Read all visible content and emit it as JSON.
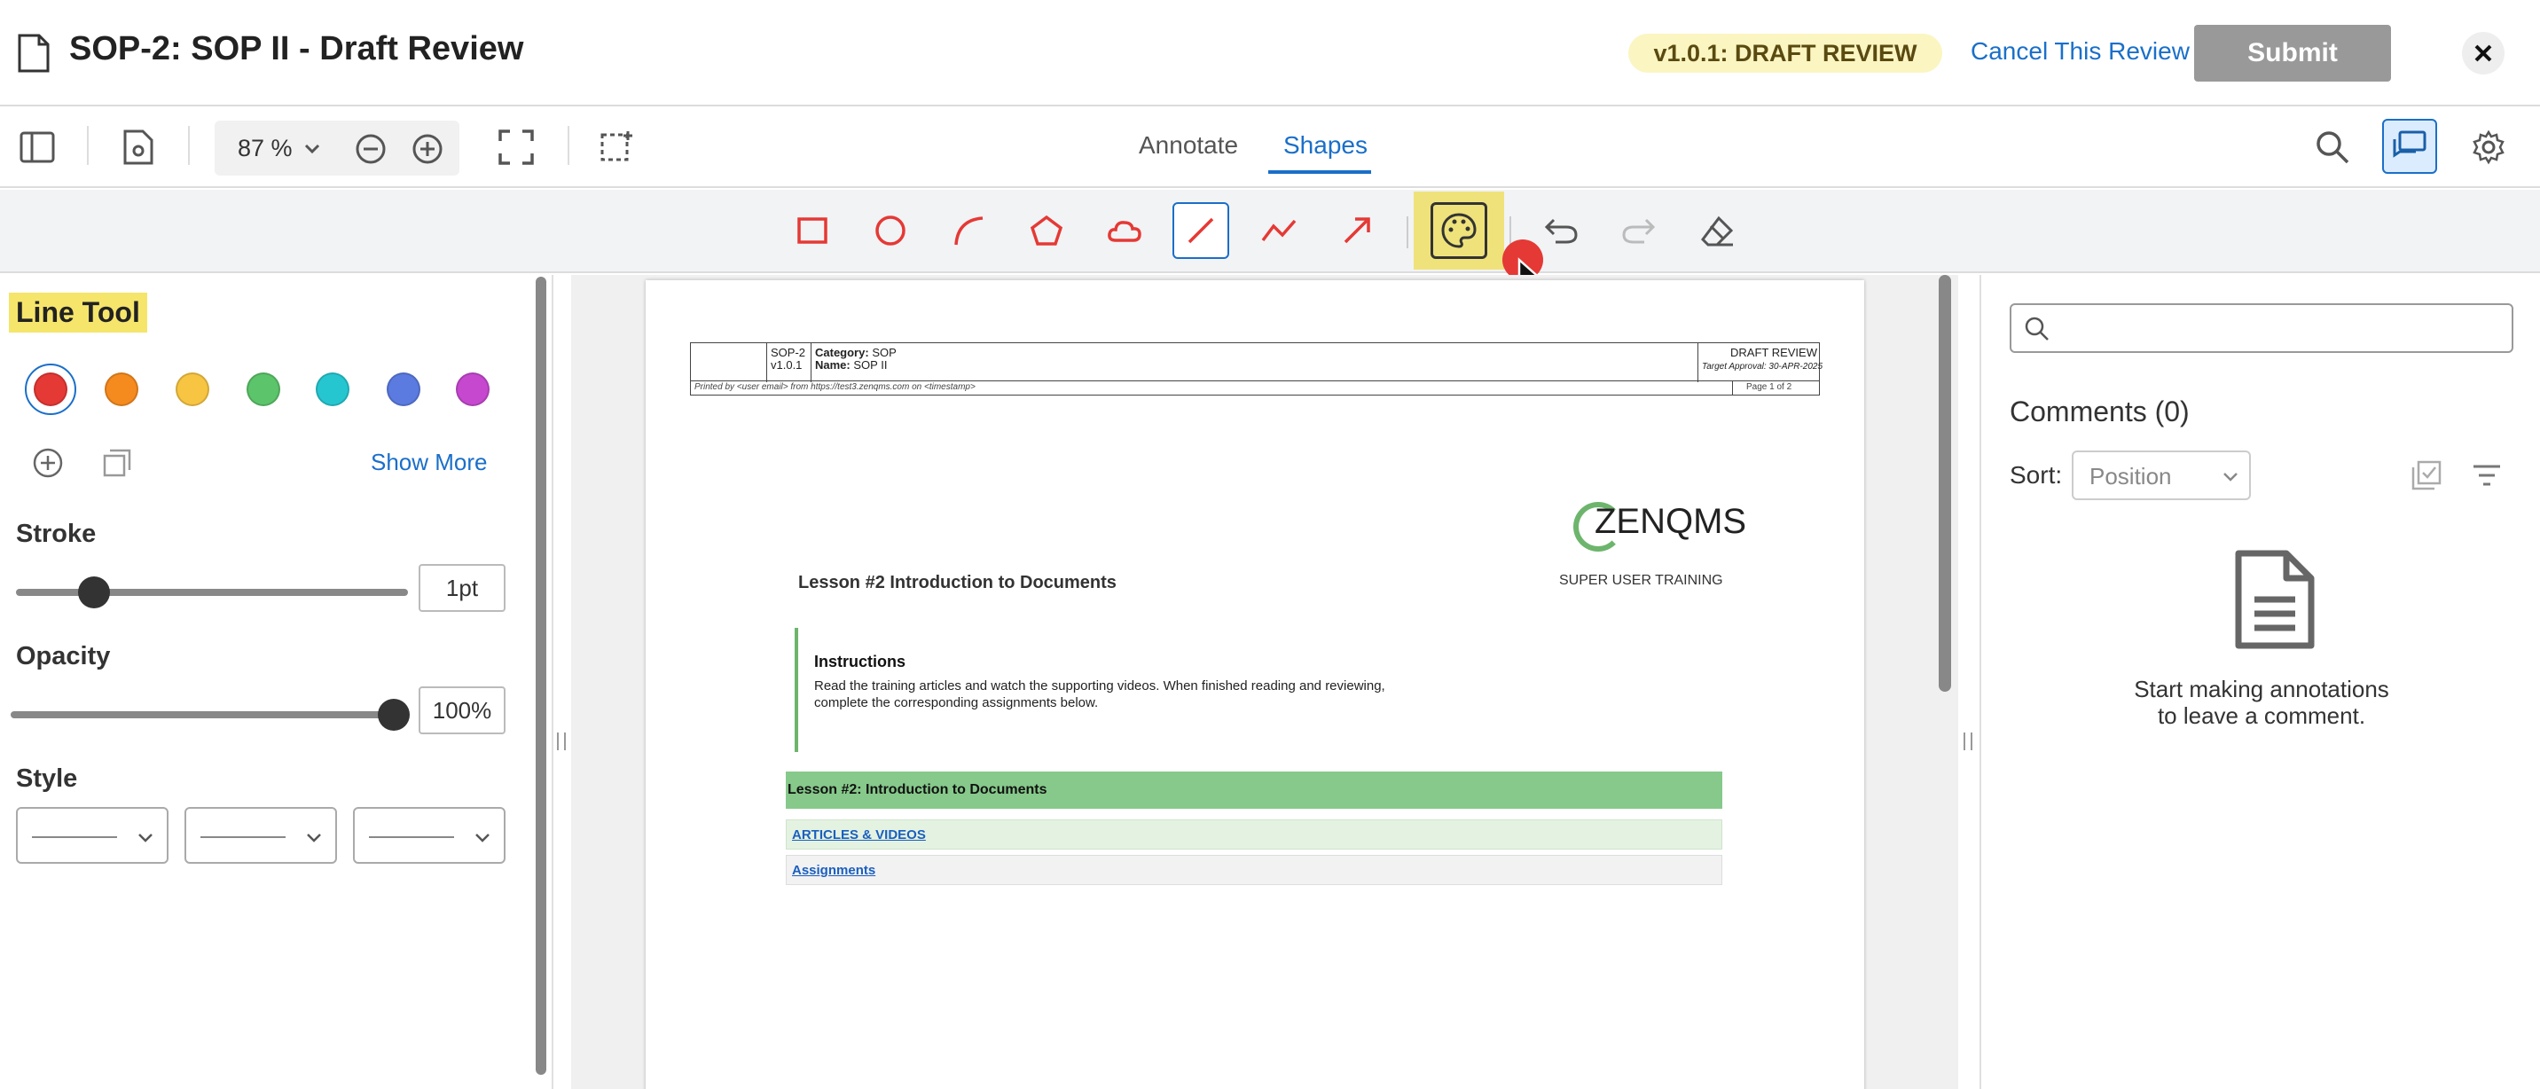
{
  "header": {
    "title": "SOP-2: SOP II - Draft Review",
    "version_badge": "v1.0.1: DRAFT REVIEW",
    "cancel_label": "Cancel This Review",
    "submit_label": "Submit"
  },
  "toolbar": {
    "zoom": "87 %",
    "tabs": [
      {
        "label": "Annotate",
        "active": false
      },
      {
        "label": "Shapes",
        "active": true
      }
    ]
  },
  "shapes": {
    "tools": [
      "rectangle-icon",
      "ellipse-icon",
      "arc-icon",
      "polygon-icon",
      "cloud-icon",
      "line-icon",
      "polyline-icon",
      "arrow-icon"
    ],
    "selected": "line-icon",
    "accent": "#e53935"
  },
  "left_panel": {
    "title": "Line Tool",
    "swatches": [
      "#e53935",
      "#f58a1f",
      "#f7c542",
      "#5cc46a",
      "#26c6d0",
      "#5b7be0",
      "#c548cf"
    ],
    "show_more": "Show More",
    "stroke_label": "Stroke",
    "stroke_value": "1pt",
    "stroke_fraction": 0.2,
    "opacity_label": "Opacity",
    "opacity_value": "100%",
    "opacity_fraction": 1.0,
    "style_label": "Style"
  },
  "document": {
    "header": {
      "code": "SOP-2",
      "version": "v1.0.1",
      "category_label": "Category:",
      "category_value": "SOP",
      "name_label": "Name:",
      "name_value": "SOP II",
      "status": "DRAFT REVIEW",
      "target": "Target Approval: 30-APR-2025",
      "printed_by": "Printed by <user email> from https://test3.zenqms.com on <timestamp>",
      "page": "Page 1 of 2"
    },
    "logo_text": "ZENQMS",
    "logo_sub": "SUPER USER TRAINING",
    "lesson_title": "Lesson #2 Introduction to Documents",
    "instructions_title": "Instructions",
    "instructions_line1": "Read the training articles and watch the supporting videos. When finished reading and reviewing,",
    "instructions_line2": "complete the corresponding assignments below.",
    "band_title": "Lesson #2: Introduction to Documents",
    "link_articles": "ARTICLES & VIDEOS",
    "link_assignments": "Assignments"
  },
  "right_panel": {
    "search_placeholder": "",
    "comments_title": "Comments (0)",
    "sort_label": "Sort:",
    "sort_value": "Position",
    "empty_line1": "Start making annotations",
    "empty_line2": "to leave a comment."
  }
}
